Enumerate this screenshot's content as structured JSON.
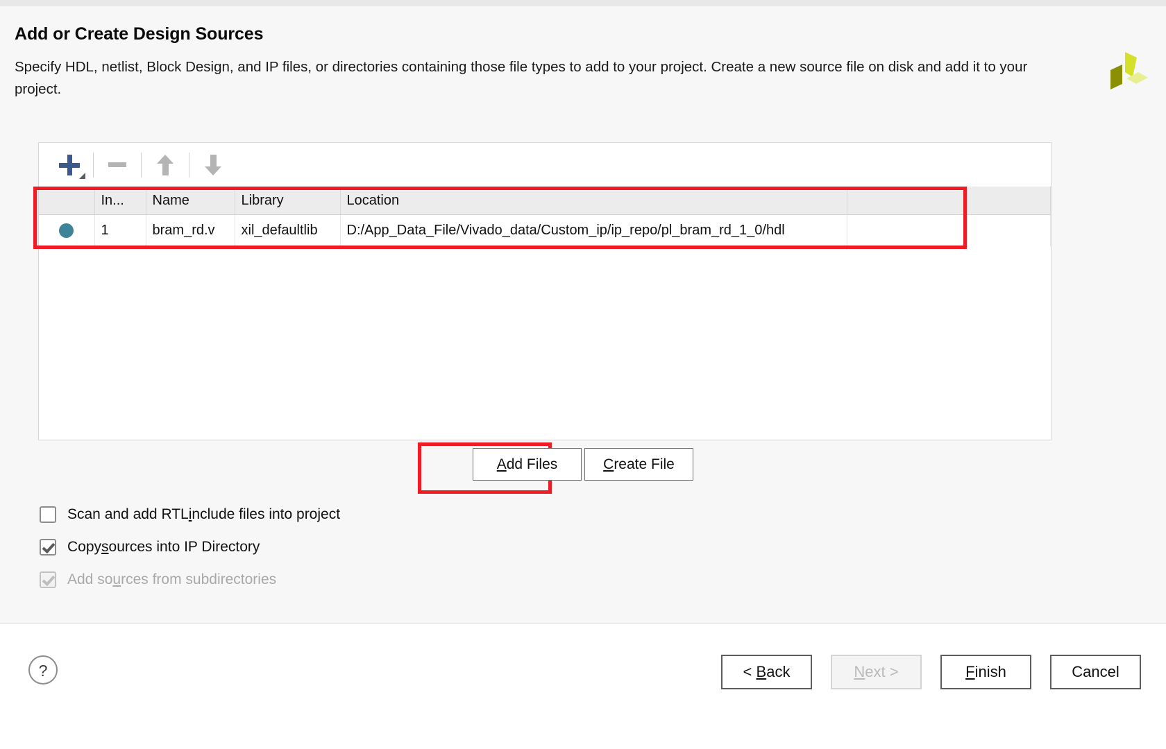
{
  "dialog": {
    "title": "Add or Create Design Sources",
    "description": "Specify HDL, netlist, Block Design, and IP files, or directories containing those file types to add to your project. Create a new source file on disk and add it to your project.",
    "logo_icon": "xilinx-logo-icon",
    "logo_colors": {
      "left": "#8a8f04",
      "top": "#d4e02a",
      "right": "#e8ef93"
    }
  },
  "toolbar": {
    "add_icon": "plus-icon",
    "add_dropdown_icon": "caret-down-icon",
    "remove_icon": "minus-icon",
    "move_up_icon": "arrow-up-icon",
    "move_down_icon": "arrow-down-icon",
    "accent_color": "#3b5a8c",
    "disabled_color": "#b4b4b4"
  },
  "sources_table": {
    "columns": [
      "",
      "In...",
      "Name",
      "Library",
      "Location",
      ""
    ],
    "rows": [
      {
        "status_icon": "filled-circle-icon",
        "status_color": "#3d8498",
        "index": "1",
        "name": "bram_rd.v",
        "library": "xil_defaultlib",
        "location": "D:/App_Data_File/Vivado_data/Custom_ip/ip_repo/pl_bram_rd_1_0/hdl"
      }
    ]
  },
  "mid_buttons": {
    "add_files": {
      "prefix": "",
      "mnemonic": "A",
      "suffix": "dd Files"
    },
    "create_file": {
      "prefix": "",
      "mnemonic": "C",
      "suffix": "reate File"
    }
  },
  "options": [
    {
      "prefix": "Scan and add RTL ",
      "mnemonic": "i",
      "suffix": "nclude files into project",
      "checked": false,
      "disabled": false
    },
    {
      "prefix": "Copy ",
      "mnemonic": "s",
      "suffix": "ources into IP Directory",
      "checked": true,
      "disabled": false
    },
    {
      "prefix": "Add so",
      "mnemonic": "u",
      "suffix": "rces from subdirectories",
      "checked": true,
      "disabled": true
    }
  ],
  "footer": {
    "help_label": "?",
    "buttons": [
      {
        "prefix": "< ",
        "mnemonic": "B",
        "suffix": "ack",
        "disabled": false
      },
      {
        "prefix": "",
        "mnemonic": "N",
        "suffix": "ext >",
        "disabled": true
      },
      {
        "prefix": "",
        "mnemonic": "F",
        "suffix": "inish",
        "disabled": false
      },
      {
        "prefix": "Cancel",
        "mnemonic": "",
        "suffix": "",
        "disabled": false
      }
    ]
  },
  "annotations": {
    "highlight_color": "#ee1c25",
    "row_highlight": "selected source file row",
    "button_highlight": "Add Files button"
  }
}
